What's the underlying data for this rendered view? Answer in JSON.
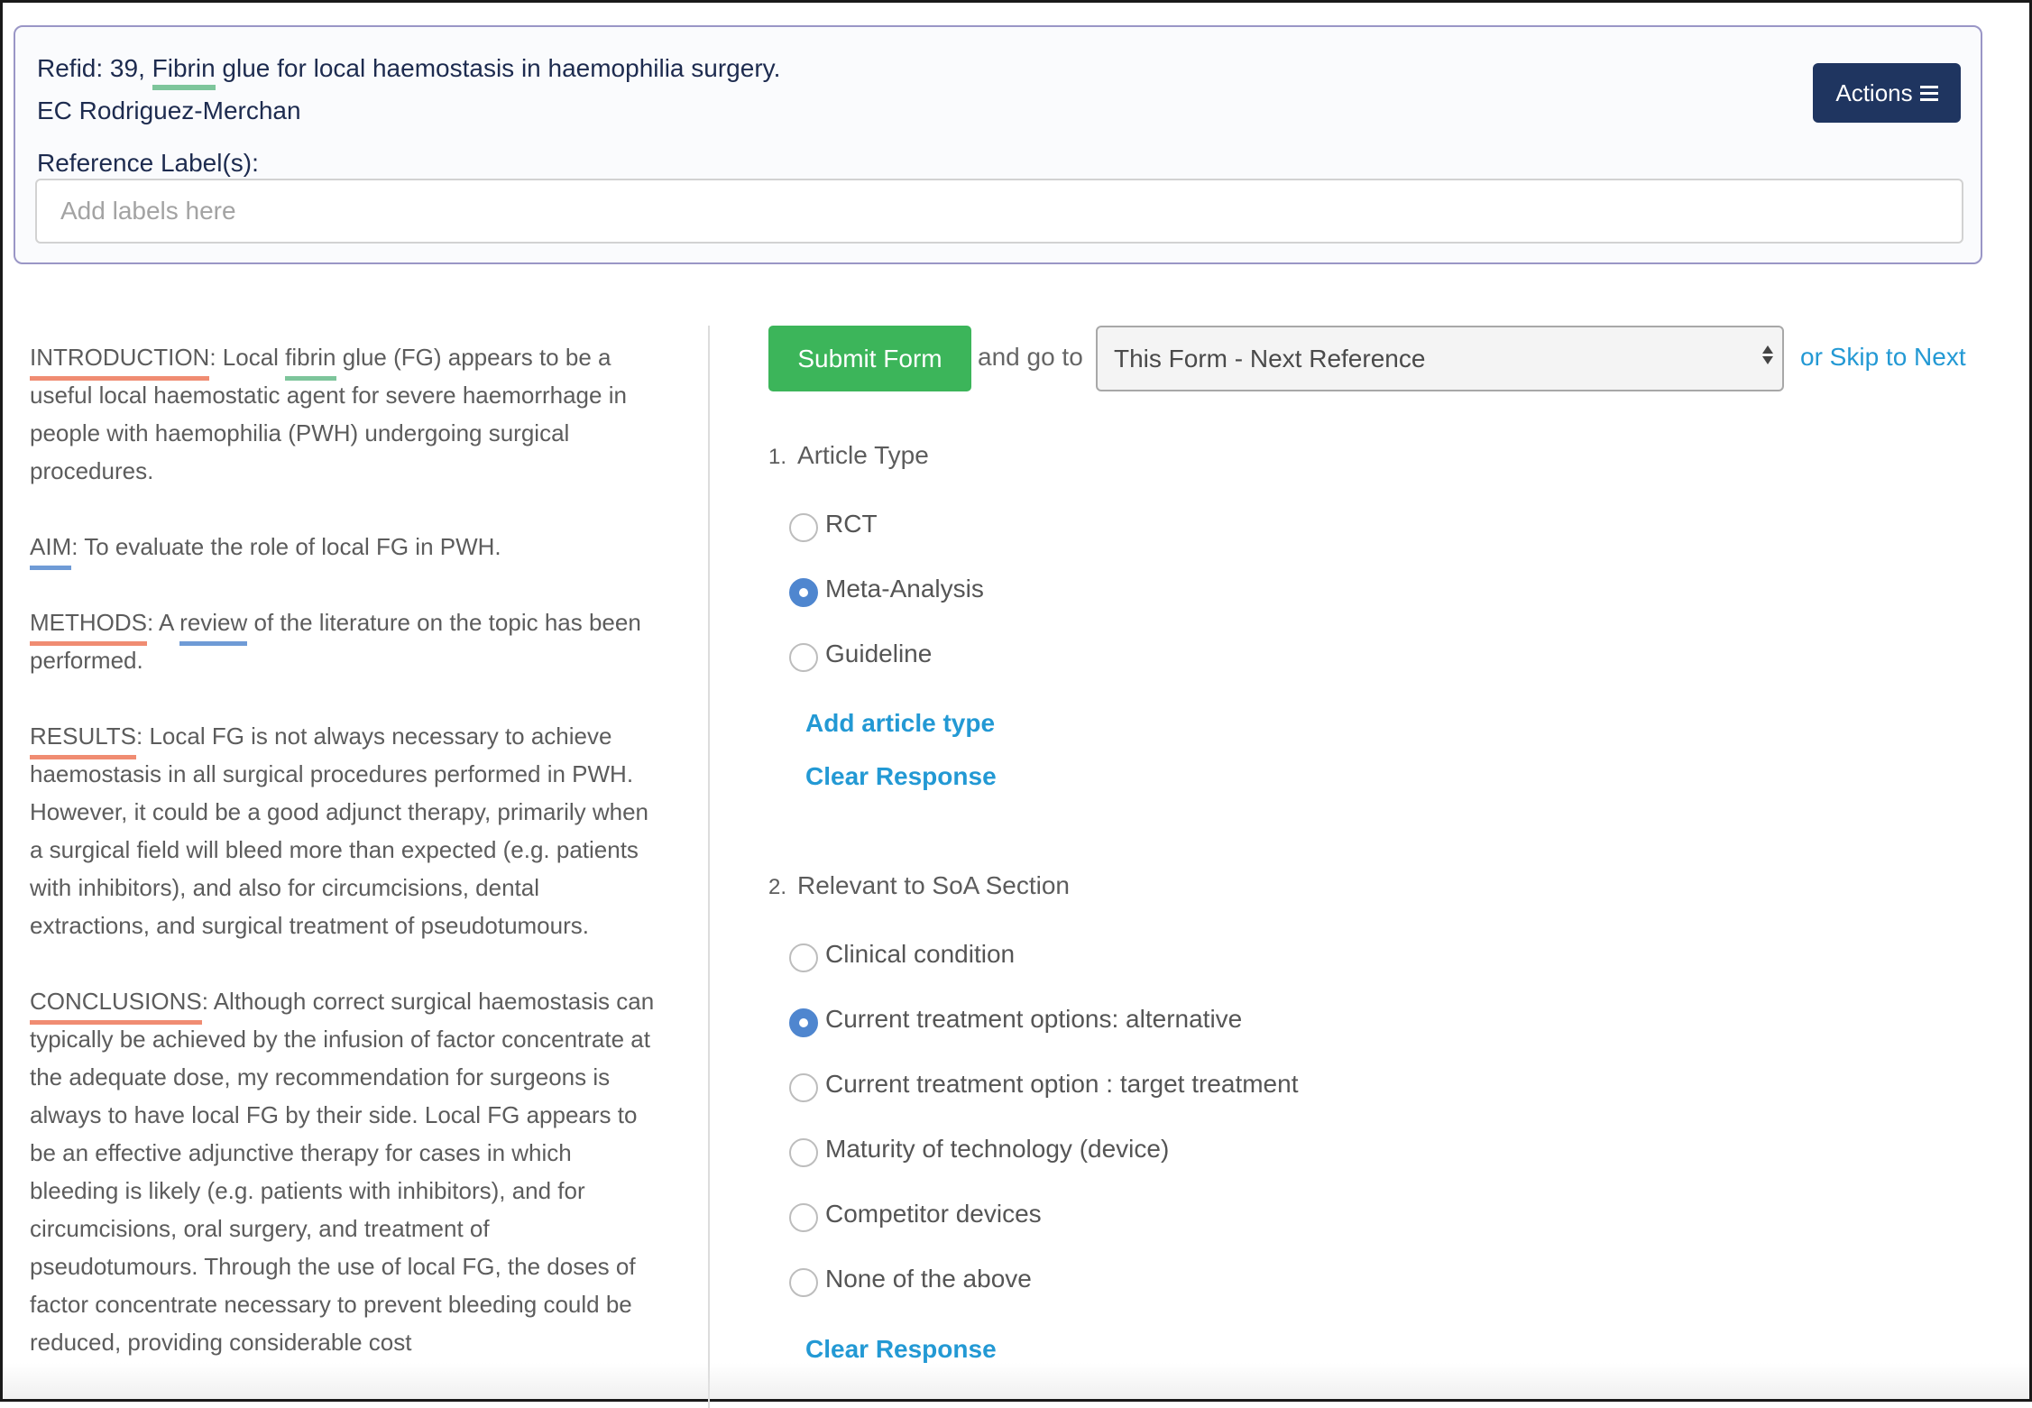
{
  "header": {
    "ref_prefix": "Refid: 39, ",
    "title_highlight": "Fibrin",
    "title_rest": " glue for local haemostasis in haemophilia surgery.",
    "author": "EC Rodriguez-Merchan",
    "labels_label": "Reference Label(s):",
    "labels_placeholder": "Add labels here",
    "actions_label": "Actions",
    "actions_icon": "hamburger-menu-icon"
  },
  "abstract": {
    "introduction": {
      "heading": "INTRODUCTION",
      "pre": ": Local ",
      "highlight": "fibrin",
      "post": " glue (FG) appears to be a useful local haemostatic agent for severe haemorrhage in people with haemophilia (PWH) undergoing surgical procedures."
    },
    "aim": {
      "heading": "AIM",
      "text": ": To evaluate the role of local FG in PWH."
    },
    "methods": {
      "heading": "METHODS",
      "pre": ": A ",
      "highlight": "review",
      "post": " of the literature on the topic has been performed."
    },
    "results": {
      "heading": "RESULTS",
      "text": ": Local FG is not always necessary to achieve haemostasis in all surgical procedures performed in PWH. However, it could be a good adjunct therapy, primarily when a surgical field will bleed more than expected (e.g. patients with inhibitors), and also for circumcisions, dental extractions, and surgical treatment of pseudotumours."
    },
    "conclusions": {
      "heading": "CONCLUSIONS",
      "text": ": Although correct surgical haemostasis can typically be achieved by the infusion of factor concentrate at the adequate dose, my recommendation for surgeons is always to have local FG by their side. Local FG appears to be an effective adjunctive therapy for cases in which bleeding is likely (e.g. patients with inhibitors), and for circumcisions, oral surgery, and treatment of pseudotumours. Through the use of local FG, the doses of factor concentrate necessary to prevent bleeding could be reduced, providing considerable cost"
    }
  },
  "form": {
    "submit_label": "Submit Form",
    "goto_label": "and go to",
    "goto_selected": "This Form - Next Reference",
    "skip_label": "or Skip to Next",
    "questions": [
      {
        "number": "1.",
        "label": "Article Type",
        "options": [
          {
            "label": "RCT",
            "checked": false
          },
          {
            "label": "Meta-Analysis",
            "checked": true
          },
          {
            "label": "Guideline",
            "checked": false
          }
        ],
        "add_label": "Add article type",
        "clear_label": "Clear Response"
      },
      {
        "number": "2.",
        "label": "Relevant to SoA Section",
        "options": [
          {
            "label": "Clinical condition",
            "checked": false
          },
          {
            "label": "Current treatment options: alternative",
            "checked": true
          },
          {
            "label": "Current treatment option : target treatment",
            "checked": false
          },
          {
            "label": "Maturity of technology (device)",
            "checked": false
          },
          {
            "label": "Competitor devices",
            "checked": false
          },
          {
            "label": "None of the above",
            "checked": false
          }
        ],
        "clear_label": "Clear Response"
      }
    ]
  },
  "colors": {
    "header_text": "#1d2b4f",
    "actions_bg": "#1f3560",
    "submit_bg": "#3cb55a",
    "link": "#2399d4",
    "radio_checked": "#4f86cf",
    "highlight_section": "#f08c72",
    "highlight_term_green": "#7dc59b",
    "highlight_term_blue": "#6f9bd6"
  }
}
